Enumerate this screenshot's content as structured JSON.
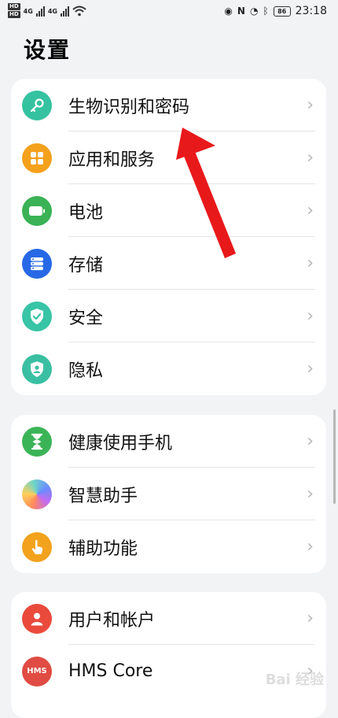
{
  "status_bar": {
    "time": "23:18",
    "battery": "86",
    "network": "4G",
    "sim_labels": [
      "HD",
      "HD"
    ]
  },
  "page": {
    "title": "设置"
  },
  "groups": [
    [
      {
        "label": "生物识别和密码",
        "icon": "key-icon",
        "color": "#35c2a0"
      },
      {
        "label": "应用和服务",
        "icon": "apps-grid-icon",
        "color": "#f4a11c"
      },
      {
        "label": "电池",
        "icon": "battery-icon",
        "color": "#3ab255"
      },
      {
        "label": "存储",
        "icon": "storage-icon",
        "color": "#2768e6"
      },
      {
        "label": "安全",
        "icon": "shield-check-icon",
        "color": "#38c4a6"
      },
      {
        "label": "隐私",
        "icon": "privacy-shield-icon",
        "color": "#3bbfa2"
      }
    ],
    [
      {
        "label": "健康使用手机",
        "icon": "hourglass-icon",
        "color": "#3bb457"
      },
      {
        "label": "智慧助手",
        "icon": "assistant-orb-icon",
        "color": "#9a7cf0"
      },
      {
        "label": "辅助功能",
        "icon": "hand-icon",
        "color": "#f3a21d"
      }
    ],
    [
      {
        "label": "用户和帐户",
        "icon": "user-icon",
        "color": "#ea4a3c"
      },
      {
        "label": "HMS Core",
        "icon": "hms-icon",
        "color": "#e04b43"
      }
    ]
  ],
  "hms_badge_text": "HMS",
  "chevron_glyph": "›",
  "watermark": "Bai 经验"
}
